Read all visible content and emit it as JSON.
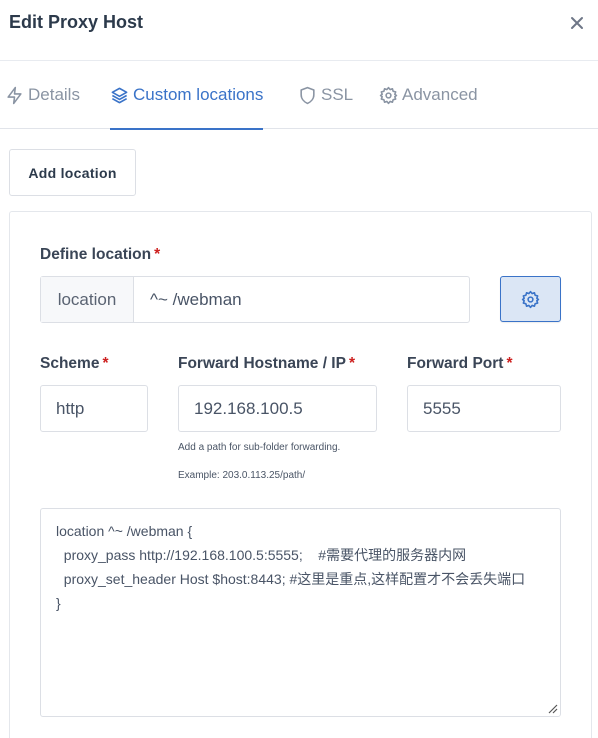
{
  "modal": {
    "title": "Edit Proxy Host",
    "close_icon": "close-icon"
  },
  "tabs": [
    {
      "label": "Details",
      "icon": "bolt-icon",
      "active": false
    },
    {
      "label": "Custom locations",
      "icon": "layers-icon",
      "active": true
    },
    {
      "label": "SSL",
      "icon": "shield-icon",
      "active": false
    },
    {
      "label": "Advanced",
      "icon": "gear-icon",
      "active": false
    }
  ],
  "add_location_label": "Add location",
  "location": {
    "define_label": "Define location",
    "required_mark": "*",
    "prepend": "location",
    "path_value": "^~ /webman",
    "settings_icon": "gear-icon",
    "scheme_label": "Scheme",
    "scheme_value": "http",
    "host_label": "Forward Hostname / IP",
    "host_value": "192.168.100.5",
    "port_label": "Forward Port",
    "port_value": "5555",
    "help_line1": "Add a path for sub-folder forwarding.",
    "help_line2": "Example: 203.0.113.25/path/",
    "config_text": "location ^~ /webman {\n  proxy_pass http://192.168.100.5:5555;    #需要代理的服务器内网\n  proxy_set_header Host $host:8443; #这里是重点,这样配置才不会丢失端口\n}"
  },
  "colors": {
    "accent": "#3a73c8",
    "required": "#cd201f",
    "text": "#354052",
    "muted": "#8a94a3"
  }
}
